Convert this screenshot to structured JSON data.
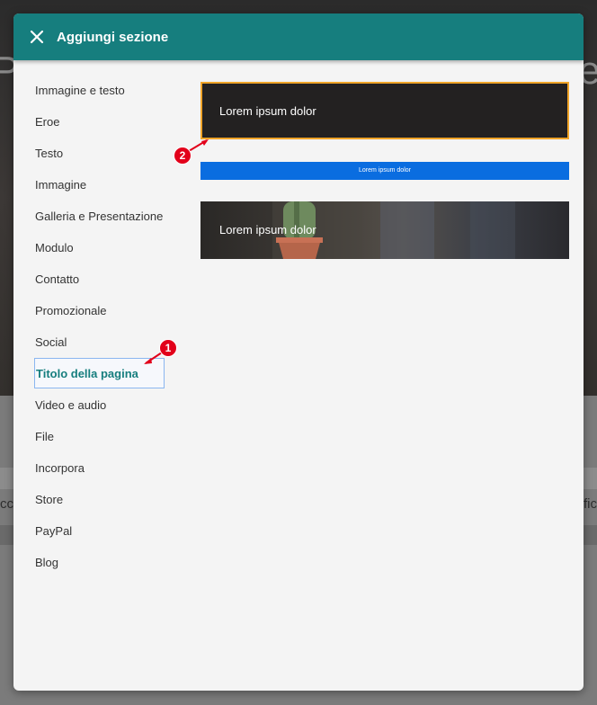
{
  "background": {
    "peek_left": "cc",
    "peek_right": "ific"
  },
  "modal": {
    "title": "Aggiungi sezione",
    "close_icon": "close-icon"
  },
  "sidebar": {
    "items": [
      {
        "label": "Immagine e testo"
      },
      {
        "label": "Eroe"
      },
      {
        "label": "Testo"
      },
      {
        "label": "Immagine"
      },
      {
        "label": "Galleria e Presentazione"
      },
      {
        "label": "Modulo"
      },
      {
        "label": "Contatto"
      },
      {
        "label": "Promozionale"
      },
      {
        "label": "Social"
      },
      {
        "label": "Titolo della pagina",
        "selected": true
      },
      {
        "label": "Video e audio"
      },
      {
        "label": "File"
      },
      {
        "label": "Incorpora"
      },
      {
        "label": "Store"
      },
      {
        "label": "PayPal"
      },
      {
        "label": "Blog"
      }
    ]
  },
  "previews": [
    {
      "text": "Lorem ipsum dolor",
      "highlighted": true
    },
    {
      "text": "Lorem ipsum dolor"
    },
    {
      "text": "Lorem ipsum dolor"
    }
  ],
  "annotations": [
    {
      "number": "1"
    },
    {
      "number": "2"
    }
  ],
  "colors": {
    "header": "#167e7e",
    "highlight_border": "#f0a428",
    "blue_banner": "#0a6de0",
    "marker": "#e2001a"
  }
}
